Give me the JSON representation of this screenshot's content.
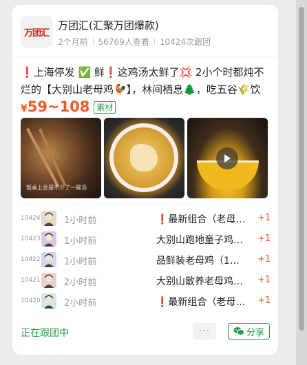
{
  "shop": {
    "logo_text": "万团汇",
    "name": "万团汇(汇聚万团爆款)",
    "posted": "2个月前",
    "views": "56769人查看",
    "followers": "10424次跟团"
  },
  "post": {
    "description": "❗上海停发 ✅ 鲜❗这鸡汤太鲜了💢 2小个时都炖不烂的【大别山老母鸡🐓】，林间栖息🌲，吃五谷🌾饮",
    "price_symbol": "¥",
    "price_range": "59~108",
    "tag": "素材",
    "photo1_caption": "饭桌上总是不少了一碗汤"
  },
  "orders": [
    {
      "no": "10424",
      "time": "1小时前",
      "title": "❗最新组合（老母鸡…",
      "qty": "+1",
      "avatar_color": "#e9d8c8"
    },
    {
      "no": "10423",
      "time": "1小时前",
      "title": "大别山跑地童子鸡…",
      "qty": "+1",
      "avatar_color": "#d9c6e6"
    },
    {
      "no": "10422",
      "time": "1小时前",
      "title": "品鲜装老母鸡（1…",
      "qty": "+1",
      "avatar_color": "#cfd8ee"
    },
    {
      "no": "10421",
      "time": "2小时前",
      "title": "大别山散养老母鸡…",
      "qty": "+1",
      "avatar_color": "#f0cdcd"
    },
    {
      "no": "10420",
      "time": "2小时前",
      "title": "❗最新组合（老母…",
      "qty": "+1",
      "avatar_color": "#cfe8e0"
    }
  ],
  "footer": {
    "following": "正在跟团中",
    "more": "···",
    "share": "分享"
  },
  "colors": {
    "accent_green": "#1fa04a",
    "price_orange": "#f05a22"
  }
}
